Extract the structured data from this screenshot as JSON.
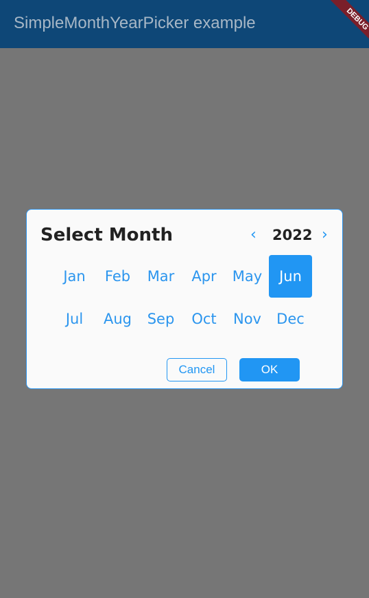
{
  "appbar": {
    "title": "SimpleMonthYearPicker example",
    "debug_label": "DEBUG"
  },
  "dialog": {
    "title": "Select Month",
    "year": "2022",
    "prev_icon": "‹",
    "next_icon": "›",
    "months": [
      "Jan",
      "Feb",
      "Mar",
      "Apr",
      "May",
      "Jun",
      "Jul",
      "Aug",
      "Sep",
      "Oct",
      "Nov",
      "Dec"
    ],
    "selected_month": "Jun",
    "cancel_label": "Cancel",
    "ok_label": "OK"
  },
  "colors": {
    "appbar": "#0e4777",
    "accent": "#2196f3",
    "scrim": "#767676",
    "dialog_bg": "#fafafa",
    "debug_ribbon": "#7a1f2a"
  }
}
